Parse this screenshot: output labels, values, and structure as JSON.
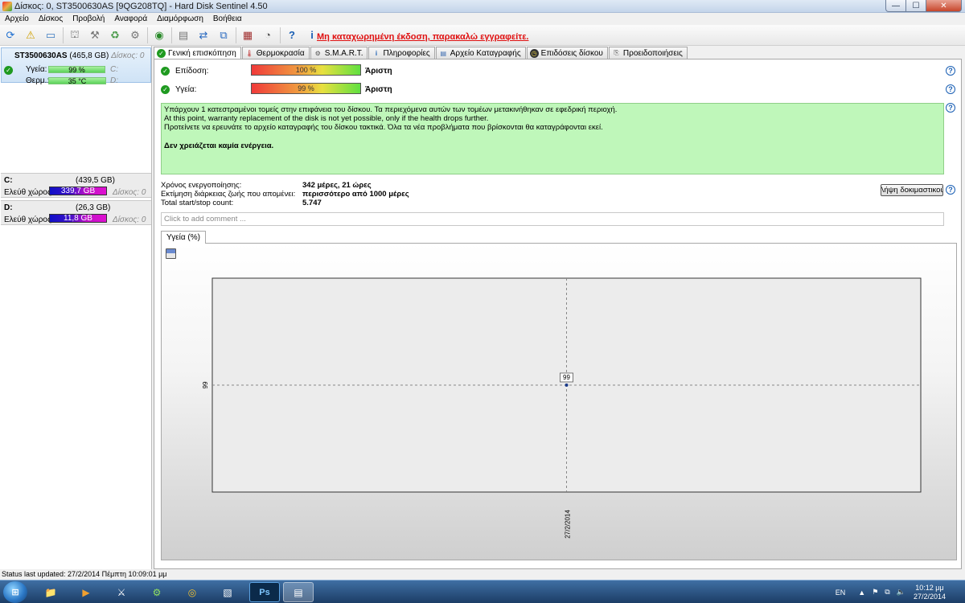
{
  "window": {
    "title": "Δίσκος: 0, ST3500630AS [9QG208TQ]  -  Hard Disk Sentinel 4.50",
    "min_label": "—",
    "max_label": "☐",
    "close_label": "✕"
  },
  "menu": [
    "Αρχείο",
    "Δίσκος",
    "Προβολή",
    "Αναφορά",
    "Διαμόρφωση",
    "Βοήθεια"
  ],
  "toolbar": {
    "register_text": "Μη καταχωρημένη έκδοση, παρακαλώ εγγραφείτε."
  },
  "left": {
    "disk": {
      "model": "ST3500630AS",
      "size": "(465,8 GB)",
      "disk_label": "Δίσκος: 0",
      "health_label": "Υγεία:",
      "health_value": "99 %",
      "health_fraction": 0.99,
      "temp_label": "Θερμ.:",
      "temp_value": "35 °C",
      "temp_fraction": 1.0,
      "drive_c": "C:",
      "drive_d": "D:"
    },
    "volumes": [
      {
        "letter": "C:",
        "size": "(439,5 GB)",
        "free_label": "Ελεύθ χώρος",
        "free_value": "339,7 GB",
        "disk_ref": "Δίσκος: 0"
      },
      {
        "letter": "D:",
        "size": "(26,3 GB)",
        "free_label": "Ελεύθ χώρος",
        "free_value": "11,8 GB",
        "disk_ref": "Δίσκος: 0"
      }
    ]
  },
  "tabs": [
    {
      "label": "Γενική επισκόπηση",
      "icon": "check-icon",
      "active": true
    },
    {
      "label": "Θερμοκρασία",
      "icon": "thermometer-icon"
    },
    {
      "label": "S.M.A.R.T.",
      "icon": "smart-icon"
    },
    {
      "label": "Πληροφορίες",
      "icon": "info-icon"
    },
    {
      "label": "Αρχείο Καταγραφής",
      "icon": "log-icon"
    },
    {
      "label": "Επιδόσεις δίσκου",
      "icon": "performance-icon"
    },
    {
      "label": "Προειδοποιήσεις",
      "icon": "alerts-icon"
    }
  ],
  "overview": {
    "performance_label": "Επίδοση:",
    "performance_value": "100 %",
    "performance_rating": "Άριστη",
    "health_label": "Υγεία:",
    "health_value": "99 %",
    "health_rating": "Άριστη",
    "message_lines": [
      "Υπάρχουν 1 κατεστραμένοι τομείς στην επιφάνεια του δίσκου. Τα περιεχόμενα αυτών των τομέων μετακινήθηκαν σε εφεδρική περιοχή.",
      "At this point, warranty replacement of the disk is not yet possible, only if the health drops further.",
      "Προτείνετε να ερευνάτε το αρχείο καταγραφής του δίσκου τακτικά. Όλα τα νέα προβλήματα που βρίσκονται θα καταγράφονται εκεί."
    ],
    "message_action": "Δεν χρειάζεται καμία ενέργεια.",
    "info": [
      {
        "key": "Χρόνος ενεργοποίησης:",
        "value": "342 μέρες, 21 ώρες"
      },
      {
        "key": "Εκτίμηση διάρκειας ζωής που απομένει:",
        "value": "περισσότερο από 1000 μέρες"
      },
      {
        "key": "Total start/stop count:",
        "value": "5.747"
      }
    ],
    "selftest_button": "Λήψη δοκιμαστικού",
    "comment_placeholder": "Click to add comment ..."
  },
  "chart_tab_label": "Υγεία (%)",
  "chart_data": {
    "type": "line",
    "x": [
      "27/2/2014"
    ],
    "series": [
      {
        "values": [
          99
        ]
      }
    ],
    "x_tick_labels": [
      "27/2/2014"
    ],
    "y_tick_labels": [
      "99"
    ],
    "data_labels": [
      "99"
    ],
    "grid": true
  },
  "statusbar": "Status last updated: 27/2/2014 Πέμπτη 10:09:01 μμ",
  "taskbar": {
    "lang": "EN",
    "time": "10:12 μμ",
    "date": "27/2/2014"
  }
}
